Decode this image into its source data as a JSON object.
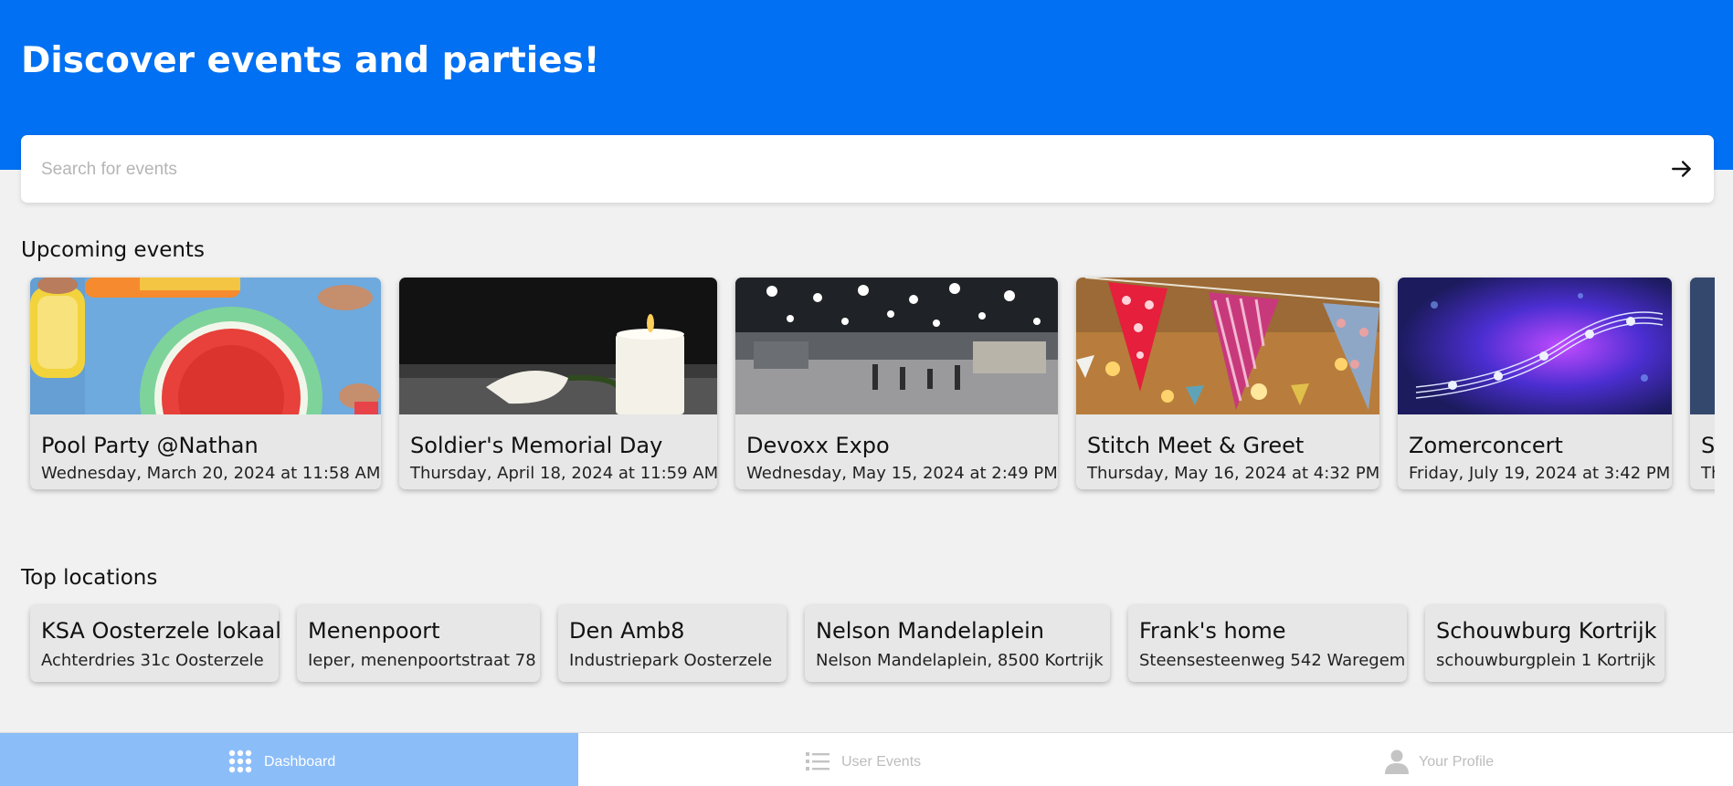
{
  "header": {
    "title": "Discover events and parties!"
  },
  "search": {
    "placeholder": "Search for events",
    "submit_icon": "arrow-right-icon"
  },
  "upcoming": {
    "title": "Upcoming events",
    "events": [
      {
        "name": "Pool Party @Nathan",
        "date": "Wednesday, March 20, 2024 at 11:58 AM"
      },
      {
        "name": "Soldier's Memorial Day",
        "date": "Thursday, April 18, 2024 at 11:59 AM"
      },
      {
        "name": "Devoxx Expo",
        "date": "Wednesday, May 15, 2024 at 2:49 PM"
      },
      {
        "name": "Stitch Meet & Greet",
        "date": "Thursday, May 16, 2024 at 4:32 PM"
      },
      {
        "name": "Zomerconcert",
        "date": "Friday, July 19, 2024 at 3:42 PM"
      },
      {
        "name": "S",
        "date": "Th"
      }
    ]
  },
  "top_locations": {
    "title": "Top locations",
    "locations": [
      {
        "name": "KSA Oosterzele lokaal",
        "address": "Achterdries 31c Oosterzele"
      },
      {
        "name": "Menenpoort",
        "address": "Ieper, menenpoortstraat 78"
      },
      {
        "name": "Den Amb8",
        "address": "Industriepark Oosterzele"
      },
      {
        "name": "Nelson Mandelaplein",
        "address": "Nelson Mandelaplein, 8500 Kortrijk"
      },
      {
        "name": "Frank's home",
        "address": "Steensesteenweg 542 Waregem"
      },
      {
        "name": "Schouwburg Kortrijk",
        "address": "schouwburgplein 1 Kortrijk"
      }
    ]
  },
  "bottom_nav": {
    "items": [
      {
        "label": "Dashboard",
        "icon": "grid-icon",
        "active": true
      },
      {
        "label": "User Events",
        "icon": "list-icon",
        "active": false
      },
      {
        "label": "Your Profile",
        "icon": "user-icon",
        "active": false
      }
    ]
  },
  "colors": {
    "primary": "#0170f2",
    "active_nav": "#8bbdf9",
    "background": "#f1f1f1",
    "card": "#e7e7e7"
  }
}
